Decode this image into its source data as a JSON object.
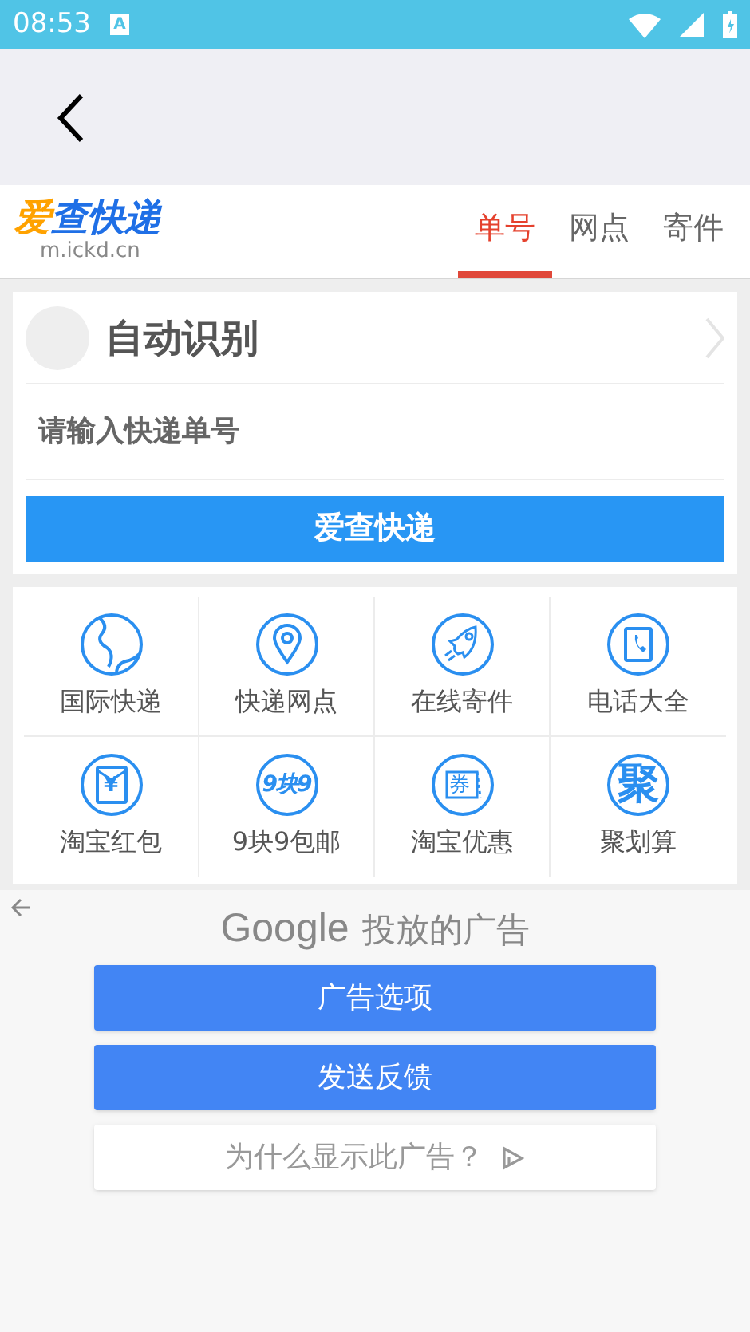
{
  "status_bar": {
    "time": "08:53",
    "notification_glyph": "A"
  },
  "logo": {
    "parts": [
      {
        "text": "爱",
        "color": "#ffa200"
      },
      {
        "text": "查快递",
        "color": "#1f6fe6"
      }
    ],
    "domain": "m.ickd.cn"
  },
  "tabs": [
    {
      "label": "单号",
      "selected": true
    },
    {
      "label": "网点",
      "selected": false
    },
    {
      "label": "寄件",
      "selected": false
    }
  ],
  "carrier": {
    "label": "自动识别"
  },
  "tracking_field": {
    "placeholder": "请输入快递单号"
  },
  "search_button": {
    "label": "爱查快递"
  },
  "shortcuts": [
    {
      "kind": "globe",
      "label": "国际快递"
    },
    {
      "kind": "pin",
      "label": "快递网点"
    },
    {
      "kind": "rocket",
      "label": "在线寄件"
    },
    {
      "kind": "phonebook",
      "label": "电话大全"
    },
    {
      "kind": "envelope",
      "label": "淘宝红包",
      "icon_text": "¥"
    },
    {
      "kind": "text",
      "label": "9块9包邮",
      "icon_text": "9块9"
    },
    {
      "kind": "ticket",
      "label": "淘宝优惠",
      "icon_text": "券"
    },
    {
      "kind": "text-bold",
      "label": "聚划算",
      "icon_text": "聚"
    }
  ],
  "ad_panel": {
    "brand": "Google",
    "title": "投放的广告",
    "buttons": [
      {
        "kind": "primary",
        "label": "广告选项"
      },
      {
        "kind": "primary",
        "label": "发送反馈"
      },
      {
        "kind": "secondary",
        "label": "为什么显示此广告？"
      }
    ]
  }
}
